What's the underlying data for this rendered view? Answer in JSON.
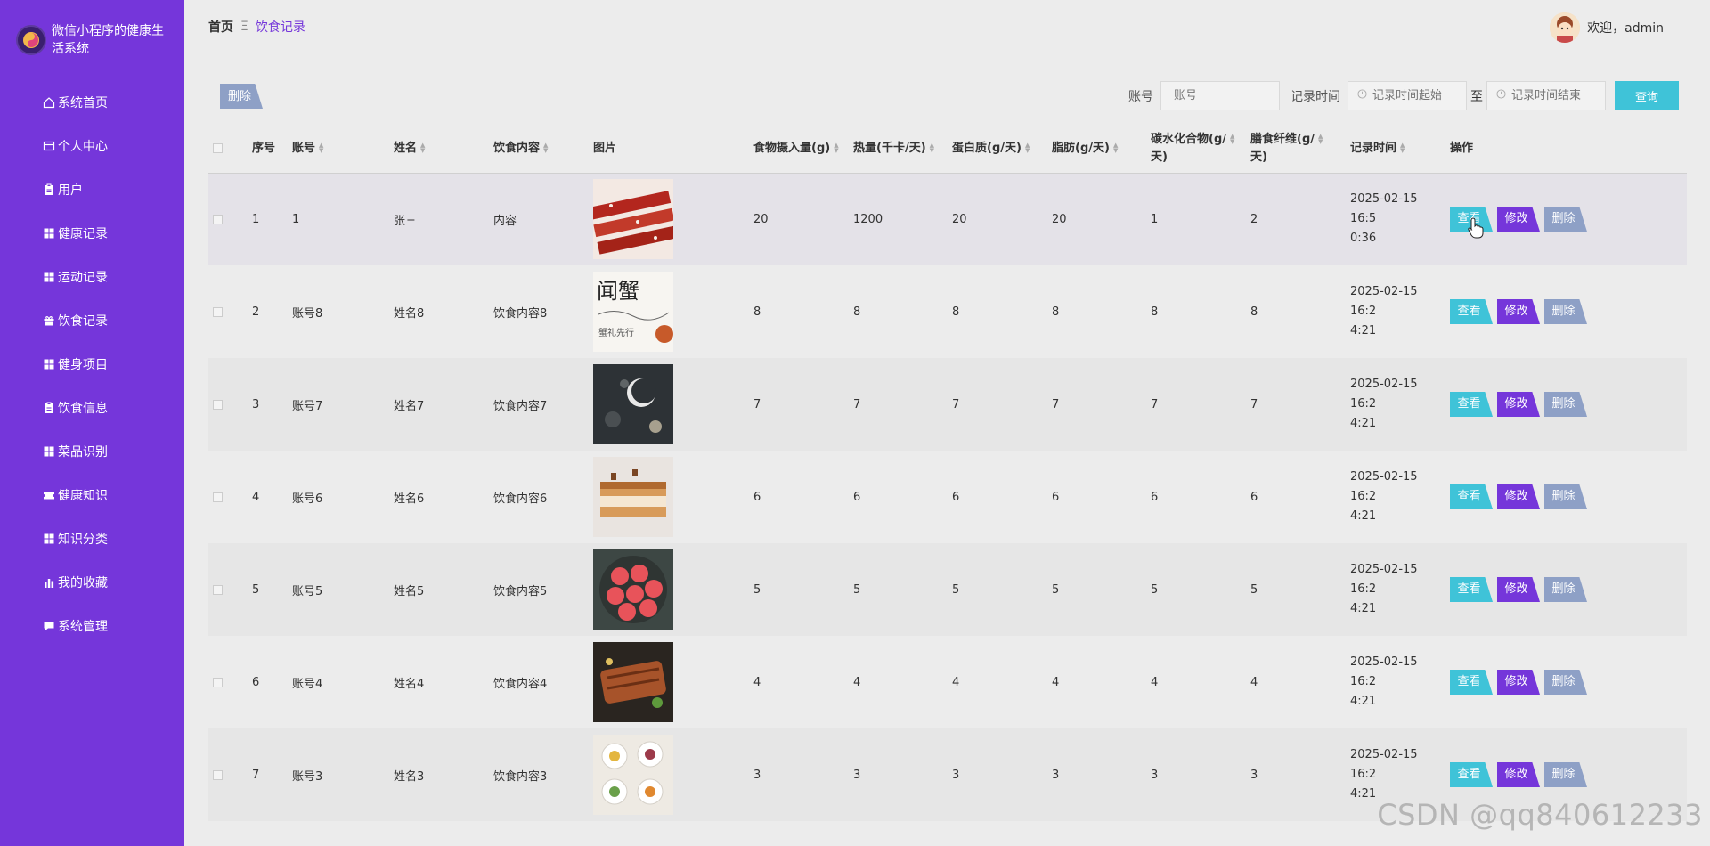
{
  "app": {
    "title": "微信小程序的健康生活系统"
  },
  "sidebar": {
    "items": [
      {
        "label": "系统首页",
        "icon": "home-icon"
      },
      {
        "label": "个人中心",
        "icon": "profile-icon"
      },
      {
        "label": "用户",
        "icon": "clipboard-icon"
      },
      {
        "label": "健康记录",
        "icon": "grid-icon"
      },
      {
        "label": "运动记录",
        "icon": "grid-icon"
      },
      {
        "label": "饮食记录",
        "icon": "gift-icon"
      },
      {
        "label": "健身项目",
        "icon": "grid-icon"
      },
      {
        "label": "饮食信息",
        "icon": "clipboard-icon"
      },
      {
        "label": "菜品识别",
        "icon": "grid-icon"
      },
      {
        "label": "健康知识",
        "icon": "ticket-icon"
      },
      {
        "label": "知识分类",
        "icon": "grid-icon"
      },
      {
        "label": "我的收藏",
        "icon": "bar-chart-icon"
      },
      {
        "label": "系统管理",
        "icon": "chat-icon"
      }
    ]
  },
  "header": {
    "breadcrumb_home": "首页",
    "breadcrumb_sep": "Ξ",
    "breadcrumb_current": "饮食记录",
    "welcome": "欢迎，admin"
  },
  "toolbar": {
    "delete_label": "删除",
    "account_label": "账号",
    "account_placeholder": "账号",
    "time_label": "记录时间",
    "time_start_placeholder": "记录时间起始",
    "to_label": "至",
    "time_end_placeholder": "记录时间结束",
    "query_label": "查询"
  },
  "table": {
    "headers": {
      "index": "序号",
      "account": "账号",
      "name": "姓名",
      "content": "饮食内容",
      "image": "图片",
      "intake": "食物摄入量(g)",
      "calories": "热量(千卡/天)",
      "protein": "蛋白质(g/天)",
      "fat": "脂肪(g/天)",
      "carbs_line1": "碳水化合物(g/",
      "carbs_line2": "天)",
      "fiber_line1": "膳食纤维(g/",
      "fiber_line2": "天)",
      "time": "记录时间",
      "ops": "操作"
    },
    "rows": [
      {
        "index": "1",
        "account": "1",
        "name": "张三",
        "content": "内容",
        "intake": "20",
        "calories": "1200",
        "protein": "20",
        "fat": "20",
        "carbs": "1",
        "fiber": "2",
        "time_line1": "2025-02-15 16:5",
        "time_line2": "0:36"
      },
      {
        "index": "2",
        "account": "账号8",
        "name": "姓名8",
        "content": "饮食内容8",
        "intake": "8",
        "calories": "8",
        "protein": "8",
        "fat": "8",
        "carbs": "8",
        "fiber": "8",
        "time_line1": "2025-02-15 16:2",
        "time_line2": "4:21"
      },
      {
        "index": "3",
        "account": "账号7",
        "name": "姓名7",
        "content": "饮食内容7",
        "intake": "7",
        "calories": "7",
        "protein": "7",
        "fat": "7",
        "carbs": "7",
        "fiber": "7",
        "time_line1": "2025-02-15 16:2",
        "time_line2": "4:21"
      },
      {
        "index": "4",
        "account": "账号6",
        "name": "姓名6",
        "content": "饮食内容6",
        "intake": "6",
        "calories": "6",
        "protein": "6",
        "fat": "6",
        "carbs": "6",
        "fiber": "6",
        "time_line1": "2025-02-15 16:2",
        "time_line2": "4:21"
      },
      {
        "index": "5",
        "account": "账号5",
        "name": "姓名5",
        "content": "饮食内容5",
        "intake": "5",
        "calories": "5",
        "protein": "5",
        "fat": "5",
        "carbs": "5",
        "fiber": "5",
        "time_line1": "2025-02-15 16:2",
        "time_line2": "4:21"
      },
      {
        "index": "6",
        "account": "账号4",
        "name": "姓名4",
        "content": "饮食内容4",
        "intake": "4",
        "calories": "4",
        "protein": "4",
        "fat": "4",
        "carbs": "4",
        "fiber": "4",
        "time_line1": "2025-02-15 16:2",
        "time_line2": "4:21"
      },
      {
        "index": "7",
        "account": "账号3",
        "name": "姓名3",
        "content": "饮食内容3",
        "intake": "3",
        "calories": "3",
        "protein": "3",
        "fat": "3",
        "carbs": "3",
        "fiber": "3",
        "time_line1": "2025-02-15 16:2",
        "time_line2": "4:21"
      }
    ],
    "op_view": "查看",
    "op_edit": "修改",
    "op_delete": "删除"
  },
  "watermark": "CSDN @qq840612233",
  "colors": {
    "sidebar": "#7536da",
    "view": "#3fc3d8",
    "edit": "#7536da",
    "delete": "#8ea0c6"
  }
}
